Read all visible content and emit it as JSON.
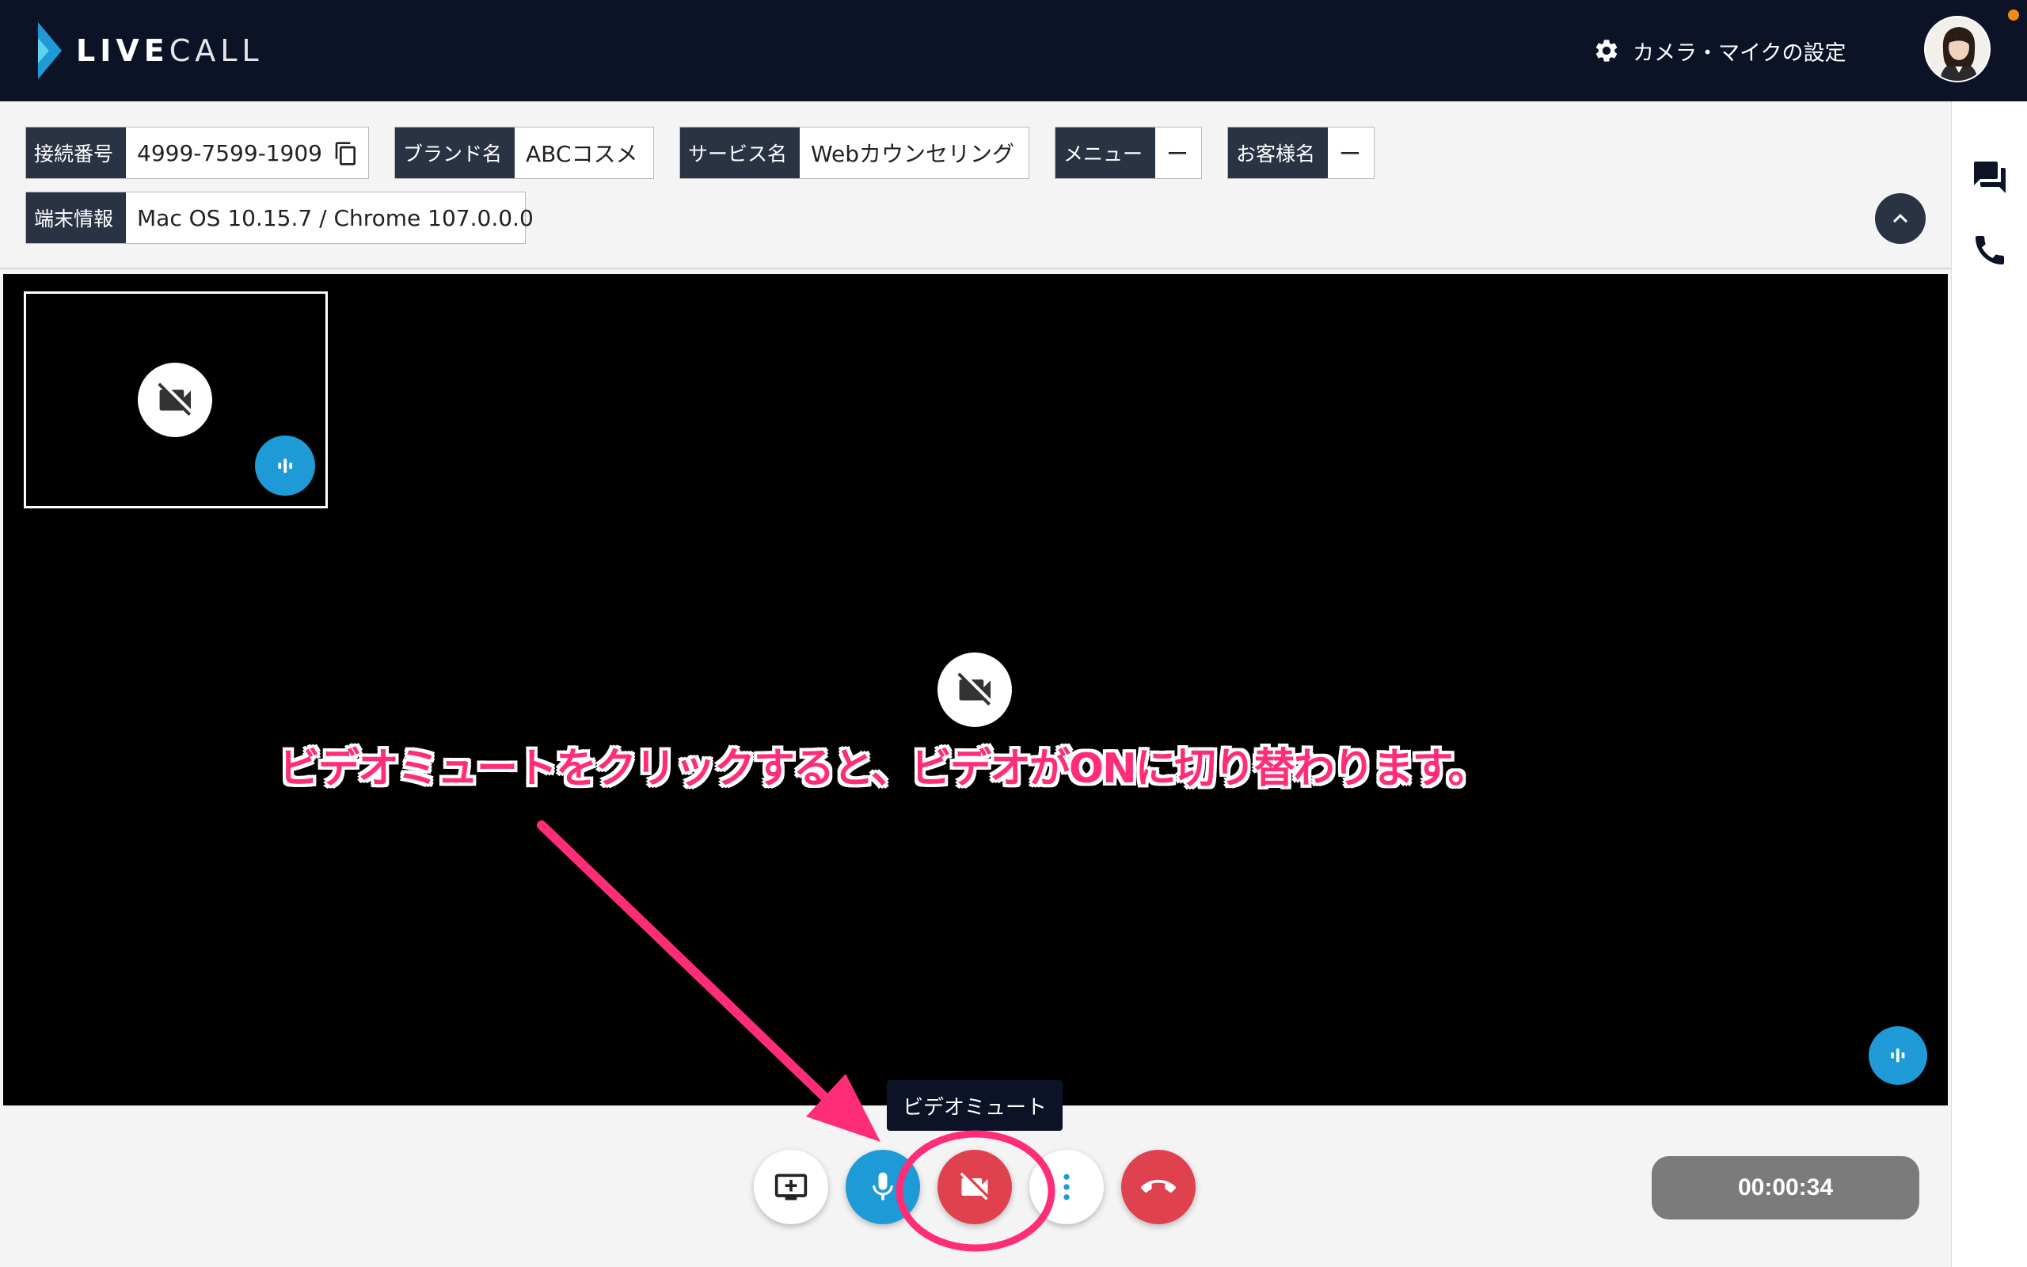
{
  "header": {
    "logo": {
      "text_bold": "LIVE",
      "text_light": "CALL"
    },
    "settings_label": "カメラ・マイクの設定",
    "has_notification": true
  },
  "info": {
    "connection": {
      "label": "接続番号",
      "value": "4999-7599-1909"
    },
    "brand": {
      "label": "ブランド名",
      "value": "ABCコスメ"
    },
    "service": {
      "label": "サービス名",
      "value": "Webカウンセリング"
    },
    "menu": {
      "label": "メニュー",
      "value": "ー"
    },
    "customer": {
      "label": "お客様名",
      "value": "ー"
    },
    "device": {
      "label": "端末情報",
      "value": "Mac OS 10.15.7 / Chrome 107.0.0.0"
    }
  },
  "video": {
    "remote_camera": "off",
    "self_camera": "off"
  },
  "annotation": {
    "text": "ビデオミュートをクリックすると、ビデオがONに切り替わります。",
    "color": "#ff2d78"
  },
  "tooltip": {
    "text": "ビデオミュート"
  },
  "controls": {
    "buttons": [
      {
        "id": "screen-share",
        "icon": "screen-share-icon",
        "color": "#ffffff"
      },
      {
        "id": "mic",
        "icon": "mic-icon",
        "color": "#1e9bd7"
      },
      {
        "id": "video-mute",
        "icon": "videocam-off-icon",
        "color": "#e0414f"
      },
      {
        "id": "more",
        "icon": "more-vertical-icon",
        "color": "#ffffff"
      },
      {
        "id": "hang-up",
        "icon": "call-end-icon",
        "color": "#e0414f"
      }
    ],
    "timer": "00:00:34"
  },
  "colors": {
    "header_bg": "#0d1327",
    "label_bg": "#2a3343",
    "accent_blue": "#1e9bd7",
    "danger_red": "#e0414f",
    "annotation_pink": "#ff2d78"
  }
}
